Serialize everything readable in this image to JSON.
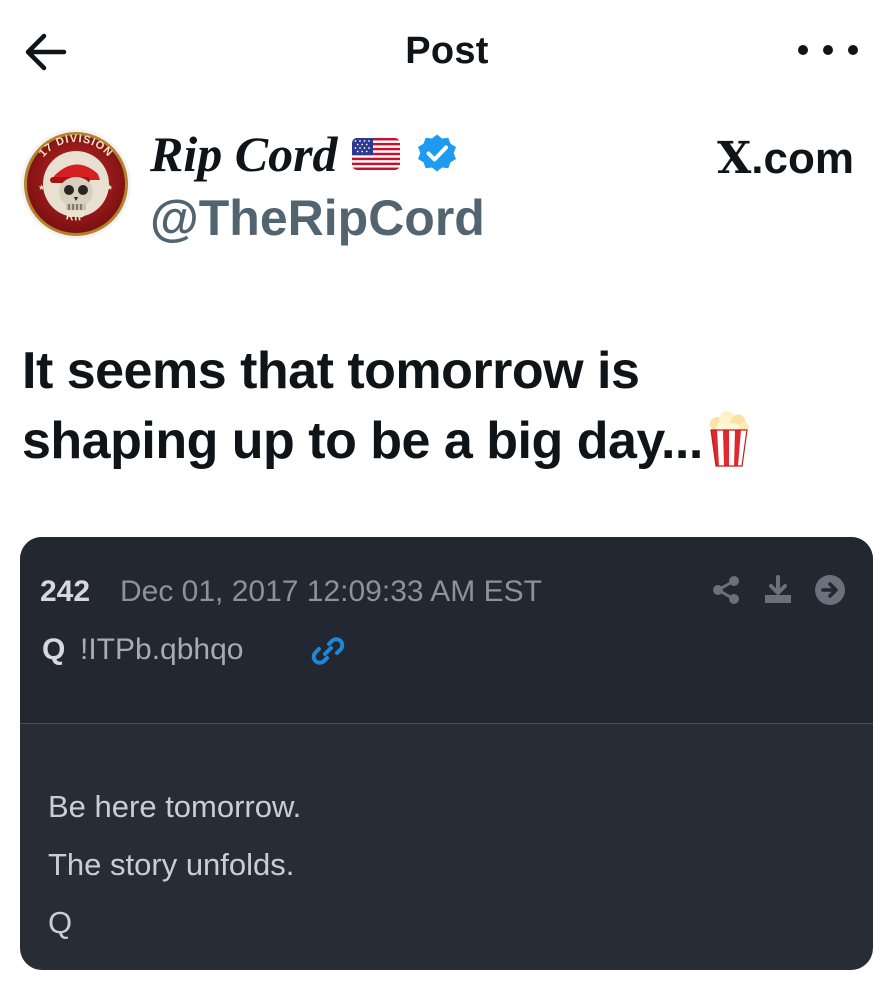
{
  "topbar": {
    "title": "Post",
    "back_icon": "arrow-left-icon",
    "more_icon": "more-horizontal-icon"
  },
  "author": {
    "display_name": "Rip Cord",
    "handle": "@TheRipCord",
    "flag_icon": "us-flag-icon",
    "verified_icon": "verified-badge-icon",
    "verified_color": "#1d9bf0",
    "avatar": {
      "top_text": "17 DIVISION",
      "bottom_text": "RIP"
    }
  },
  "source_label": "X.com",
  "post": {
    "lines": [
      "It seems that tomorrow is",
      "shaping up to be a big day..."
    ],
    "emoji_icon": "popcorn-icon"
  },
  "embedded_card": {
    "post_number": "242",
    "date": "Dec 01, 2017 12:09:33 AM EST",
    "poster": "Q",
    "tripcode": "!ITPb.qbhqo",
    "link_icon": "link-icon",
    "link_color": "#1e88d8",
    "action_icons": [
      "share-icon",
      "download-icon",
      "arrow-right-circle-icon"
    ],
    "message_lines": [
      "Be here tomorrow.",
      "The story unfolds.",
      "Q"
    ]
  }
}
